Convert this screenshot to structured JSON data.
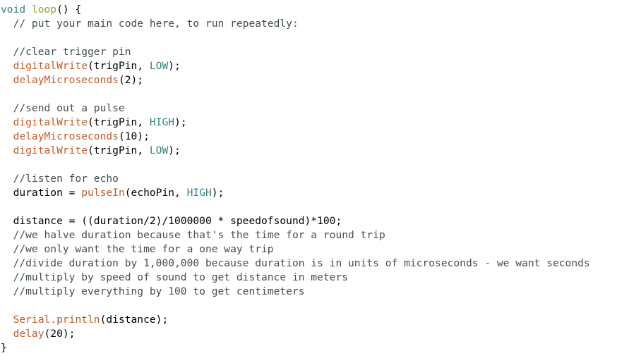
{
  "document": {
    "kind": "source-code-listing",
    "language": "Arduino C++",
    "background_color": "#ffffff"
  },
  "theme": {
    "keyword_color": "#35827f",
    "function_name_color": "#9b9b3d",
    "builtin_function_color": "#bc5d28",
    "comment_color": "#434f54",
    "plain_text_color": "#000000"
  },
  "code": {
    "lines": [
      {
        "id": "line-1",
        "blank": false,
        "tokens": [
          {
            "t": "void",
            "c": "keyword"
          },
          {
            "t": " ",
            "c": "plain"
          },
          {
            "t": "loop",
            "c": "fnname"
          },
          {
            "t": "() {",
            "c": "plain"
          }
        ]
      },
      {
        "id": "line-2",
        "blank": false,
        "tokens": [
          {
            "t": "  // put your main code here, to run repeatedly:",
            "c": "comment"
          }
        ]
      },
      {
        "id": "line-3",
        "blank": true,
        "tokens": [
          {
            "t": "",
            "c": "plain"
          }
        ]
      },
      {
        "id": "line-4",
        "blank": false,
        "tokens": [
          {
            "t": "  //clear trigger pin",
            "c": "comment"
          }
        ]
      },
      {
        "id": "line-5",
        "blank": false,
        "tokens": [
          {
            "t": "  ",
            "c": "plain"
          },
          {
            "t": "digitalWrite",
            "c": "builtin"
          },
          {
            "t": "(trigPin, ",
            "c": "plain"
          },
          {
            "t": "LOW",
            "c": "keyword"
          },
          {
            "t": ");",
            "c": "plain"
          }
        ]
      },
      {
        "id": "line-6",
        "blank": false,
        "tokens": [
          {
            "t": "  ",
            "c": "plain"
          },
          {
            "t": "delayMicroseconds",
            "c": "builtin"
          },
          {
            "t": "(2);",
            "c": "plain"
          }
        ]
      },
      {
        "id": "line-7",
        "blank": true,
        "tokens": [
          {
            "t": "",
            "c": "plain"
          }
        ]
      },
      {
        "id": "line-8",
        "blank": false,
        "tokens": [
          {
            "t": "  //send out a pulse",
            "c": "comment"
          }
        ]
      },
      {
        "id": "line-9",
        "blank": false,
        "tokens": [
          {
            "t": "  ",
            "c": "plain"
          },
          {
            "t": "digitalWrite",
            "c": "builtin"
          },
          {
            "t": "(trigPin, ",
            "c": "plain"
          },
          {
            "t": "HIGH",
            "c": "keyword"
          },
          {
            "t": ");",
            "c": "plain"
          }
        ]
      },
      {
        "id": "line-10",
        "blank": false,
        "tokens": [
          {
            "t": "  ",
            "c": "plain"
          },
          {
            "t": "delayMicroseconds",
            "c": "builtin"
          },
          {
            "t": "(10);",
            "c": "plain"
          }
        ]
      },
      {
        "id": "line-11",
        "blank": false,
        "tokens": [
          {
            "t": "  ",
            "c": "plain"
          },
          {
            "t": "digitalWrite",
            "c": "builtin"
          },
          {
            "t": "(trigPin, ",
            "c": "plain"
          },
          {
            "t": "LOW",
            "c": "keyword"
          },
          {
            "t": ");",
            "c": "plain"
          }
        ]
      },
      {
        "id": "line-12",
        "blank": true,
        "tokens": [
          {
            "t": "",
            "c": "plain"
          }
        ]
      },
      {
        "id": "line-13",
        "blank": false,
        "tokens": [
          {
            "t": "  //listen for echo",
            "c": "comment"
          }
        ]
      },
      {
        "id": "line-14",
        "blank": false,
        "tokens": [
          {
            "t": "  duration = ",
            "c": "plain"
          },
          {
            "t": "pulseIn",
            "c": "builtin"
          },
          {
            "t": "(echoPin, ",
            "c": "plain"
          },
          {
            "t": "HIGH",
            "c": "keyword"
          },
          {
            "t": ");",
            "c": "plain"
          }
        ]
      },
      {
        "id": "line-15",
        "blank": true,
        "tokens": [
          {
            "t": "",
            "c": "plain"
          }
        ]
      },
      {
        "id": "line-16",
        "blank": false,
        "tokens": [
          {
            "t": "  distance = ((duration/2)/1000000 * speedofsound)*100;",
            "c": "plain"
          }
        ]
      },
      {
        "id": "line-17",
        "blank": false,
        "tokens": [
          {
            "t": "  //we halve duration because that's the time for a round trip",
            "c": "comment"
          }
        ]
      },
      {
        "id": "line-18",
        "blank": false,
        "tokens": [
          {
            "t": "  //we only want the time for a one way trip",
            "c": "comment"
          }
        ]
      },
      {
        "id": "line-19",
        "blank": false,
        "tokens": [
          {
            "t": "  //divide duration by 1,000,000 because duration is in units of microseconds - we want seconds",
            "c": "comment"
          }
        ]
      },
      {
        "id": "line-20",
        "blank": false,
        "tokens": [
          {
            "t": "  //multiply by speed of sound to get distance in meters",
            "c": "comment"
          }
        ]
      },
      {
        "id": "line-21",
        "blank": false,
        "tokens": [
          {
            "t": "  //multiply everything by 100 to get centimeters",
            "c": "comment"
          }
        ]
      },
      {
        "id": "line-22",
        "blank": true,
        "tokens": [
          {
            "t": "",
            "c": "plain"
          }
        ]
      },
      {
        "id": "line-23",
        "blank": false,
        "tokens": [
          {
            "t": "  ",
            "c": "plain"
          },
          {
            "t": "Serial.println",
            "c": "builtin"
          },
          {
            "t": "(distance);",
            "c": "plain"
          }
        ]
      },
      {
        "id": "line-24",
        "blank": false,
        "tokens": [
          {
            "t": "  ",
            "c": "plain"
          },
          {
            "t": "delay",
            "c": "builtin"
          },
          {
            "t": "(20);",
            "c": "plain"
          }
        ]
      },
      {
        "id": "line-25",
        "blank": false,
        "tokens": [
          {
            "t": "}",
            "c": "plain"
          }
        ]
      }
    ]
  }
}
